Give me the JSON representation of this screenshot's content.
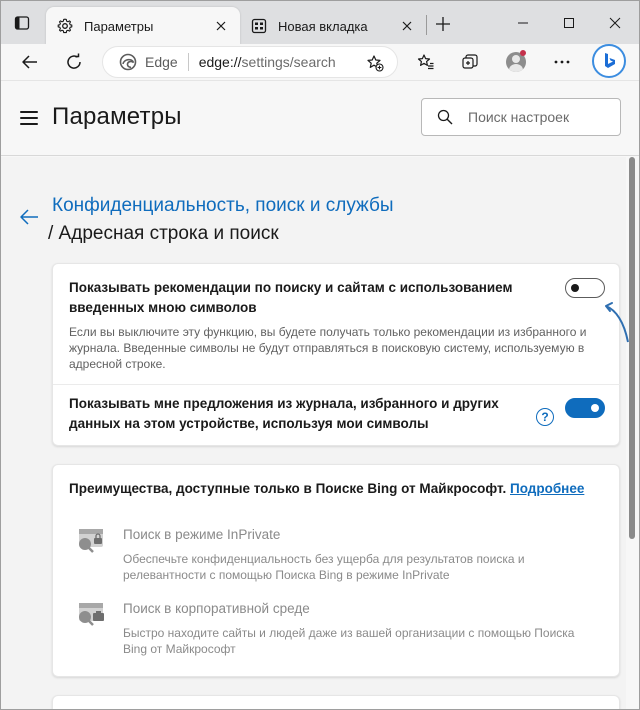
{
  "browser": {
    "tabs": [
      {
        "title": "Параметры",
        "icon": "gear-icon",
        "active": true
      },
      {
        "title": "Новая вкладка",
        "icon": "new-tab-page-icon",
        "active": false
      }
    ],
    "address": {
      "brand": "Edge",
      "url_scheme": "edge://",
      "url_path": "settings/search"
    }
  },
  "settings": {
    "title": "Параметры",
    "search_placeholder": "Поиск настроек"
  },
  "breadcrumb": {
    "parent": "Конфиденциальность, поиск и службы",
    "current": "/ Адресная строка и поиск"
  },
  "card1": {
    "row1": {
      "title_line1": "Показывать рекомендации по поиску и сайтам с использованием",
      "title_line2": "введенных мною символов",
      "desc_line1": "Если вы выключите эту функцию, вы будете получать только рекомендации из избранного и",
      "desc_line2": "журнала. Введенные символы не будут отправляться в поисковую систему, используемую в",
      "desc_line3": "адресной строке.",
      "toggle": "off"
    },
    "row2": {
      "title_line1": "Показывать мне предложения из журнала, избранного и других",
      "title_line2": "данных на этом устройстве, используя мои символы",
      "help": "?",
      "toggle": "on"
    }
  },
  "card2": {
    "intro": "Преимущества, доступные только в Поиске Bing от Майкрософт.",
    "link": "Подробнее",
    "features": [
      {
        "title": "Поиск в режиме InPrivate",
        "desc_line1": "Обеспечьте конфиденциальность без ущерба для результатов поиска и",
        "desc_line2": "релевантности с помощью Поиска Bing в режиме InPrivate",
        "icon": "inprivate-search-icon"
      },
      {
        "title": "Поиск в корпоративной среде",
        "desc_line1": "Быстро находите сайты и людей даже из вашей организации с помощью Поиска",
        "desc_line2": "Bing от Майкрософт",
        "icon": "enterprise-search-icon"
      }
    ]
  },
  "colors": {
    "accent": "#0f6cbd",
    "toggle_on": "#0f6cbd"
  }
}
